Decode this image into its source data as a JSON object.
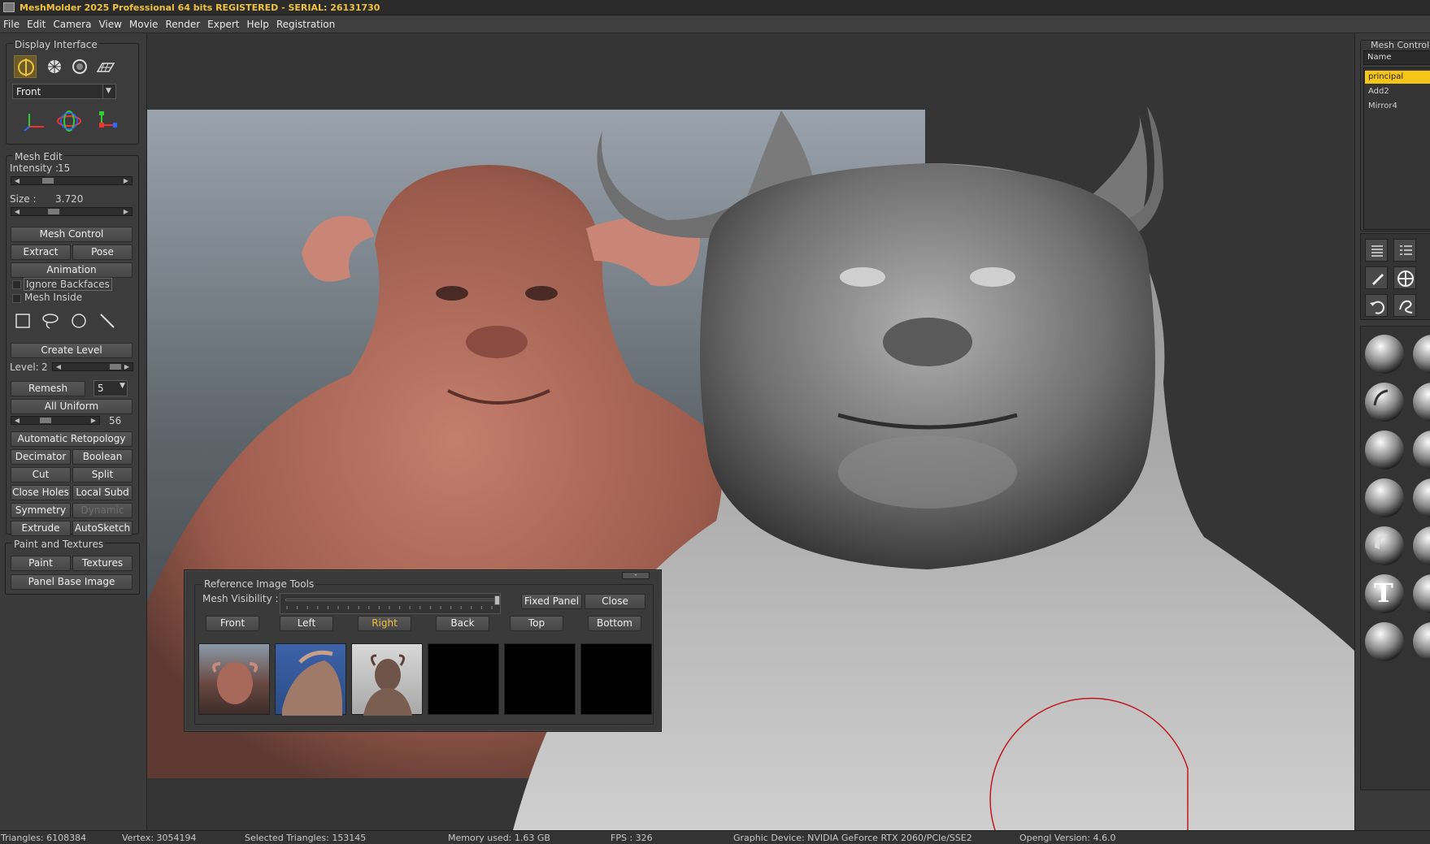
{
  "title": "MeshMolder 2025 Professional 64 bits REGISTERED - SERIAL: 26131730",
  "menu": [
    "File",
    "Edit",
    "Camera",
    "View",
    "Movie",
    "Render",
    "Expert",
    "Help",
    "Registration"
  ],
  "display_interface": {
    "title": "Display Interface",
    "view_select": "Front"
  },
  "mesh_edit": {
    "title": "Mesh Edit",
    "intensity_label": "Intensity :",
    "intensity_value": "15",
    "intensity_level": 0.2,
    "size_label": "Size :",
    "size_value": "3.720",
    "size_level": 0.25,
    "mesh_control": "Mesh Control",
    "extract": "Extract",
    "pose": "Pose",
    "animation": "Animation",
    "ignore_backfaces": "Ignore Backfaces",
    "mesh_inside": "Mesh Inside",
    "create_level": "Create Level",
    "level_label": "Level:",
    "level_value": "2",
    "remesh": "Remesh",
    "remesh_value": "5",
    "all_uniform": "All Uniform",
    "uniform_value": "56",
    "automatic_retopology": "Automatic Retopology",
    "decimator": "Decimator",
    "boolean": "Boolean",
    "cut": "Cut",
    "split": "Split",
    "close_holes": "Close Holes",
    "local_subd": "Local Subd",
    "symmetry": "Symmetry",
    "dynamic": "Dynamic",
    "extrude": "Extrude",
    "autosketch": "AutoSketch"
  },
  "paint_textures": {
    "title": "Paint and Textures",
    "paint": "Paint",
    "textures": "Textures",
    "panel_base_image": "Panel Base Image"
  },
  "ref_tools": {
    "title": "Reference Image Tools",
    "mesh_visibility": "Mesh Visibility :",
    "visibility_level": 0.98,
    "minimize": "-",
    "fixed_panel": "Fixed Panel",
    "close": "Close",
    "views": [
      "Front",
      "Left",
      "Right",
      "Back",
      "Top",
      "Bottom"
    ],
    "active_view": "Right"
  },
  "mesh_control_panel": {
    "title": "Mesh Control",
    "column": "Name",
    "items": [
      "principal",
      "Add2",
      "Mirror4"
    ],
    "selected": "principal"
  },
  "status": {
    "triangles": "Triangles: 6108384",
    "vertex": "Vertex: 3054194",
    "selected": "Selected Triangles: 153145",
    "memory": "Memory used: 1.63 GB",
    "fps": "FPS : 326",
    "device": "Graphic Device: NVIDIA GeForce RTX 2060/PCIe/SSE2",
    "opengl": "Opengl Version: 4.6.0"
  },
  "colors": {
    "accent": "#f0c23c",
    "selected_row": "#f5c518",
    "brush_circle": "#c0181e",
    "clay": "#b26a5a",
    "sculpt": "#8a8a8a"
  }
}
